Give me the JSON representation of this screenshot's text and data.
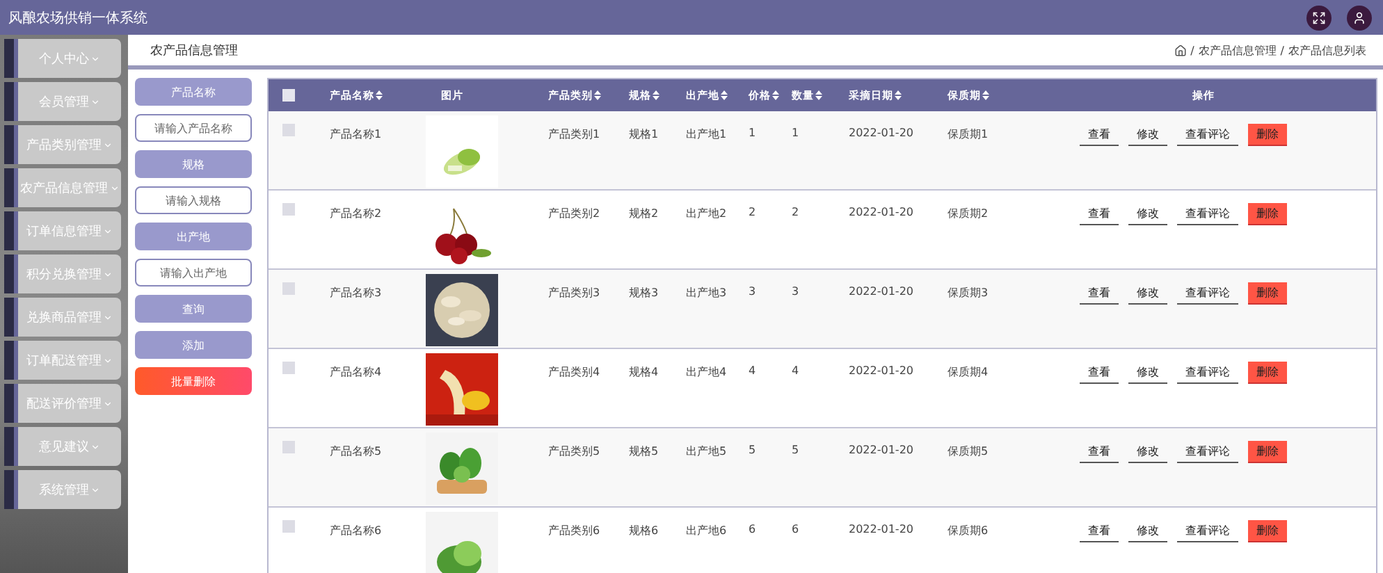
{
  "window": {
    "title": "风酿农场供销一体系统"
  },
  "sidebar": {
    "items": [
      {
        "label": "个人中心"
      },
      {
        "label": "会员管理"
      },
      {
        "label": "产品类别管理"
      },
      {
        "label": "农产品信息管理"
      },
      {
        "label": "订单信息管理"
      },
      {
        "label": "积分兑换管理"
      },
      {
        "label": "兑换商品管理"
      },
      {
        "label": "订单配送管理"
      },
      {
        "label": "配送评价管理"
      },
      {
        "label": "意见建议"
      },
      {
        "label": "系统管理"
      }
    ]
  },
  "page_title": "农产品信息管理",
  "breadcrumb": {
    "separator": "/",
    "items": [
      "农产品信息管理",
      "农产品信息列表"
    ]
  },
  "search": [
    {
      "kind": "label",
      "text": "产品名称"
    },
    {
      "kind": "input",
      "placeholder": "请输入产品名称"
    },
    {
      "kind": "label",
      "text": "规格"
    },
    {
      "kind": "input",
      "placeholder": "请输入规格"
    },
    {
      "kind": "label",
      "text": "出产地"
    },
    {
      "kind": "input",
      "placeholder": "请输入出产地"
    },
    {
      "kind": "button",
      "text": "查询"
    },
    {
      "kind": "button",
      "text": "添加"
    },
    {
      "kind": "danger",
      "text": "批量删除"
    }
  ],
  "table": {
    "select_all": {
      "checked": false
    },
    "columns": [
      {
        "label": "产品名称",
        "sortable": true
      },
      {
        "label": "图片",
        "sortable": false
      },
      {
        "label": "产品类别",
        "sortable": true
      },
      {
        "label": "规格",
        "sortable": true
      },
      {
        "label": "出产地",
        "sortable": true
      },
      {
        "label": "价格",
        "sortable": true
      },
      {
        "label": "数量",
        "sortable": true
      },
      {
        "label": "采摘日期",
        "sortable": true
      },
      {
        "label": "保质期",
        "sortable": true
      },
      {
        "label": "操作",
        "sortable": false
      }
    ],
    "rows": [
      {
        "checked": false,
        "cells": [
          "产品名称1",
          "",
          "产品类别1",
          "规格1",
          "出产地1",
          "1",
          "1",
          "2022-01-20",
          "保质期1"
        ],
        "actions": [
          {
            "kind": "plain",
            "label": "查看"
          },
          {
            "kind": "plain",
            "label": "修改"
          },
          {
            "kind": "plain",
            "label": "查看评论"
          },
          {
            "kind": "danger",
            "label": "删除"
          }
        ]
      },
      {
        "checked": false,
        "cells": [
          "产品名称2",
          "",
          "产品类别2",
          "规格2",
          "出产地2",
          "2",
          "2",
          "2022-01-20",
          "保质期2"
        ],
        "actions": [
          {
            "kind": "plain",
            "label": "查看"
          },
          {
            "kind": "plain",
            "label": "修改"
          },
          {
            "kind": "plain",
            "label": "查看评论"
          },
          {
            "kind": "danger",
            "label": "删除"
          }
        ]
      },
      {
        "checked": false,
        "cells": [
          "产品名称3",
          "",
          "产品类别3",
          "规格3",
          "出产地3",
          "3",
          "3",
          "2022-01-20",
          "保质期3"
        ],
        "actions": [
          {
            "kind": "plain",
            "label": "查看"
          },
          {
            "kind": "plain",
            "label": "修改"
          },
          {
            "kind": "plain",
            "label": "查看评论"
          },
          {
            "kind": "danger",
            "label": "删除"
          }
        ]
      },
      {
        "checked": false,
        "cells": [
          "产品名称4",
          "",
          "产品类别4",
          "规格4",
          "出产地4",
          "4",
          "4",
          "2022-01-20",
          "保质期4"
        ],
        "actions": [
          {
            "kind": "plain",
            "label": "查看"
          },
          {
            "kind": "plain",
            "label": "修改"
          },
          {
            "kind": "plain",
            "label": "查看评论"
          },
          {
            "kind": "danger",
            "label": "删除"
          }
        ]
      },
      {
        "checked": false,
        "cells": [
          "产品名称5",
          "",
          "产品类别5",
          "规格5",
          "出产地5",
          "5",
          "5",
          "2022-01-20",
          "保质期5"
        ],
        "actions": [
          {
            "kind": "plain",
            "label": "查看"
          },
          {
            "kind": "plain",
            "label": "修改"
          },
          {
            "kind": "plain",
            "label": "查看评论"
          },
          {
            "kind": "danger",
            "label": "删除"
          }
        ]
      },
      {
        "checked": false,
        "cells": [
          "产品名称6",
          "",
          "产品类别6",
          "规格6",
          "出产地6",
          "6",
          "6",
          "2022-01-20",
          "保质期6"
        ],
        "actions": [
          {
            "kind": "plain",
            "label": "查看"
          },
          {
            "kind": "plain",
            "label": "修改"
          },
          {
            "kind": "plain",
            "label": "查看评论"
          },
          {
            "kind": "danger",
            "label": "删除"
          }
        ]
      }
    ]
  }
}
